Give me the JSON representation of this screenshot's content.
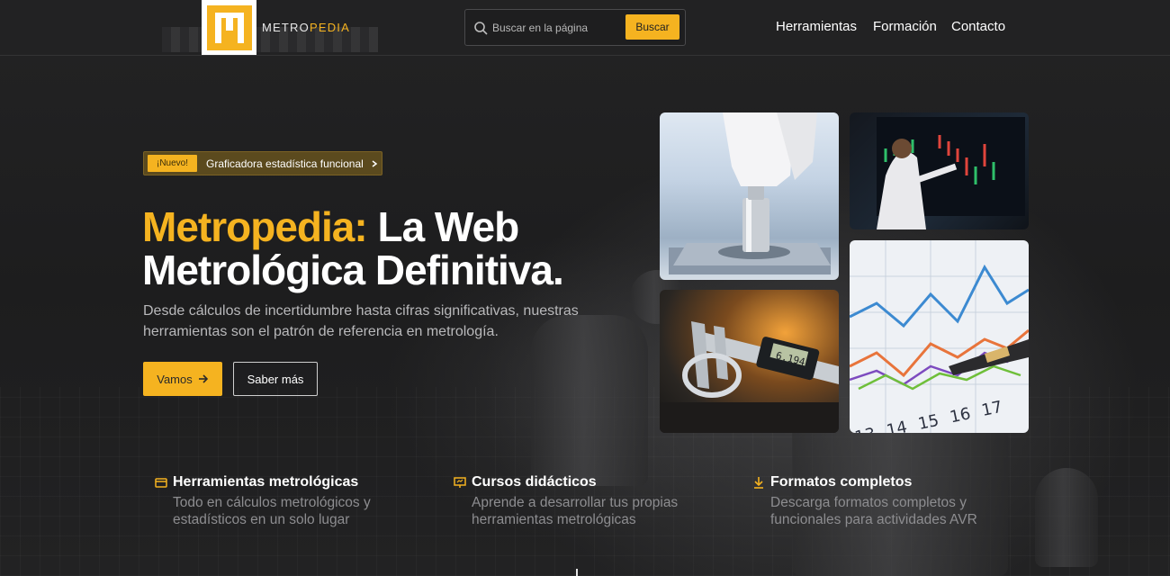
{
  "brand": {
    "name_part1": "METRO",
    "name_part2": "PEDIA",
    "accent_color": "#f5b320"
  },
  "search": {
    "placeholder": "Buscar en la página",
    "button_label": "Buscar",
    "icon": "search-icon"
  },
  "nav": {
    "items": [
      {
        "label": "Herramientas"
      },
      {
        "label": "Formación"
      },
      {
        "label": "Contacto"
      }
    ]
  },
  "hero": {
    "badge_tag": "¡Nuevo!",
    "badge_text": "Graficadora estadística funcional",
    "headline_accent": "Metropedia:",
    "headline_rest": " La Web Metrológica Definitiva.",
    "subtitle": "Desde cálculos de incertidumbre hasta cifras significativas, nuestras herramientas son el patrón de referencia en metrología.",
    "primary_button": "Vamos",
    "secondary_button": "Saber más"
  },
  "caliper_display": "6.194",
  "chart_axis_numbers": [
    "13",
    "14",
    "15",
    "16",
    "17"
  ],
  "features": [
    {
      "icon": "card-icon",
      "title": "Herramientas metrológicas",
      "desc": "Todo en cálculos metrológicos y estadísticos en un solo lugar"
    },
    {
      "icon": "presentation-icon",
      "title": "Cursos didácticos",
      "desc": "Aprende a desarrollar tus propias herramientas metrológicas"
    },
    {
      "icon": "download-icon",
      "title": "Formatos completos",
      "desc": "Descarga formatos completos y funcionales para actividades AVR"
    }
  ]
}
